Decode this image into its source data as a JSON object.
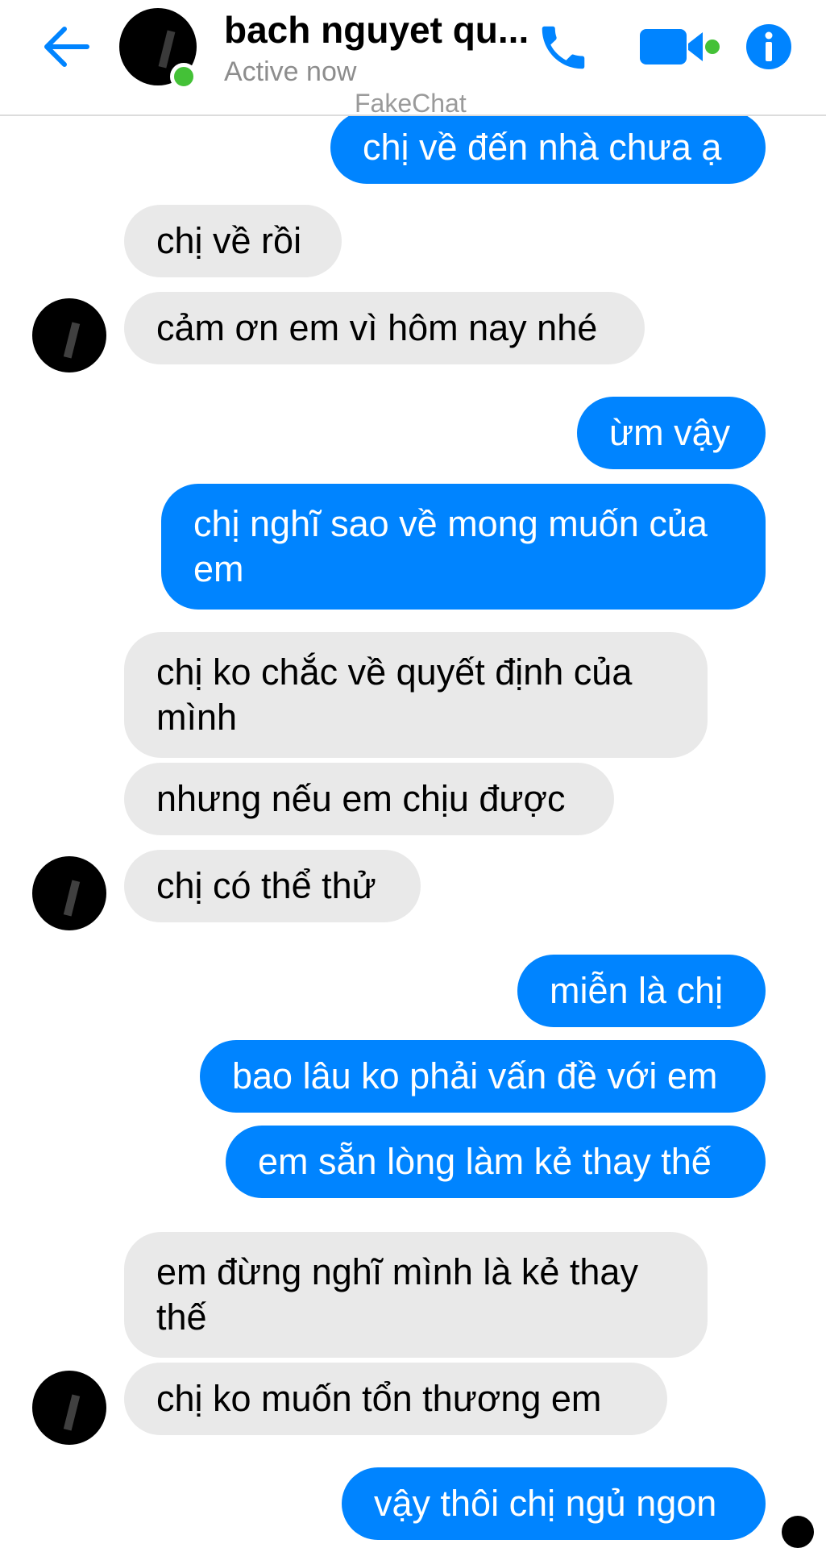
{
  "header": {
    "contact_name": "bach nguyet qu...",
    "status": "Active now",
    "watermark": "FakeChat",
    "accent_color": "#0084ff",
    "online_color": "#44c137"
  },
  "icons": {
    "back": "back-arrow-icon",
    "call": "phone-icon",
    "video": "video-camera-icon",
    "info": "info-icon"
  },
  "messages": [
    {
      "side": "sent",
      "text": "chị về đến nhà chưa ạ"
    },
    {
      "side": "recv",
      "text": "chị về rồi"
    },
    {
      "side": "recv",
      "text": "cảm ơn em vì hôm nay nhé"
    },
    {
      "side": "sent",
      "text": "ừm vậy"
    },
    {
      "side": "sent",
      "text": "chị nghĩ sao về mong muốn của em"
    },
    {
      "side": "recv",
      "text": "chị ko chắc về quyết định của mình"
    },
    {
      "side": "recv",
      "text": "nhưng nếu em chịu được"
    },
    {
      "side": "recv",
      "text": "chị có thể thử"
    },
    {
      "side": "sent",
      "text": "miễn là chị"
    },
    {
      "side": "sent",
      "text": "bao lâu ko phải vấn đề với em"
    },
    {
      "side": "sent",
      "text": "em sẵn lòng làm kẻ thay thế"
    },
    {
      "side": "recv",
      "text": "em đừng nghĩ mình là kẻ thay thế"
    },
    {
      "side": "recv",
      "text": "chị ko muốn tổn thương em"
    },
    {
      "side": "sent",
      "text": "vậy thôi chị ngủ ngon"
    }
  ]
}
